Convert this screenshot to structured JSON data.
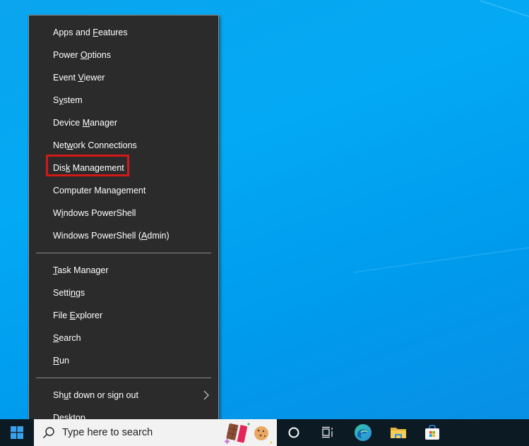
{
  "desktop": {
    "background_color": "#03a9f4"
  },
  "menu": {
    "groups": [
      {
        "items": [
          {
            "pre": "Apps and ",
            "key": "F",
            "post": "eatures",
            "label": "Apps and Features"
          },
          {
            "pre": "Power ",
            "key": "O",
            "post": "ptions",
            "label": "Power Options"
          },
          {
            "pre": "Event ",
            "key": "V",
            "post": "iewer",
            "label": "Event Viewer"
          },
          {
            "pre": "S",
            "key": "y",
            "post": "stem",
            "label": "System"
          },
          {
            "pre": "Device ",
            "key": "M",
            "post": "anager",
            "label": "Device Manager"
          },
          {
            "pre": "Net",
            "key": "w",
            "post": "ork Connections",
            "label": "Network Connections"
          },
          {
            "pre": "Dis",
            "key": "k",
            "post": " Management",
            "label": "Disk Management"
          },
          {
            "pre": "Computer Mana",
            "key": "g",
            "post": "ement",
            "label": "Computer Management"
          },
          {
            "pre": "W",
            "key": "i",
            "post": "ndows PowerShell",
            "label": "Windows PowerShell"
          },
          {
            "pre": "Windows PowerShell (",
            "key": "A",
            "post": "dmin)",
            "label": "Windows PowerShell (Admin)"
          }
        ]
      },
      {
        "items": [
          {
            "pre": "",
            "key": "T",
            "post": "ask Manager",
            "label": "Task Manager"
          },
          {
            "pre": "Setti",
            "key": "n",
            "post": "gs",
            "label": "Settings"
          },
          {
            "pre": "File ",
            "key": "E",
            "post": "xplorer",
            "label": "File Explorer"
          },
          {
            "pre": "",
            "key": "S",
            "post": "earch",
            "label": "Search"
          },
          {
            "pre": "",
            "key": "R",
            "post": "un",
            "label": "Run"
          }
        ]
      },
      {
        "items": [
          {
            "pre": "Sh",
            "key": "u",
            "post": "t down or sign out",
            "label": "Shut down or sign out",
            "submenu": true
          },
          {
            "pre": "",
            "key": "D",
            "post": "esktop",
            "label": "Desktop"
          }
        ]
      }
    ],
    "highlighted_item": "Disk Management",
    "highlight_color": "#d31818",
    "icons": {
      "submenu_arrow": "chevron-right-icon"
    }
  },
  "taskbar": {
    "start_icon": "windows-logo-icon",
    "search": {
      "placeholder": "Type here to search",
      "icon": "search-icon",
      "highlight_icon": "search-highlight-chocolate-cookie-icon"
    },
    "pinned": [
      {
        "name": "cortana",
        "icon": "cortana-circle-icon"
      },
      {
        "name": "task-view",
        "icon": "task-view-icon"
      },
      {
        "name": "microsoft-edge",
        "icon": "edge-icon"
      },
      {
        "name": "file-explorer",
        "icon": "folder-icon"
      },
      {
        "name": "microsoft-store",
        "icon": "store-bag-icon"
      }
    ]
  }
}
